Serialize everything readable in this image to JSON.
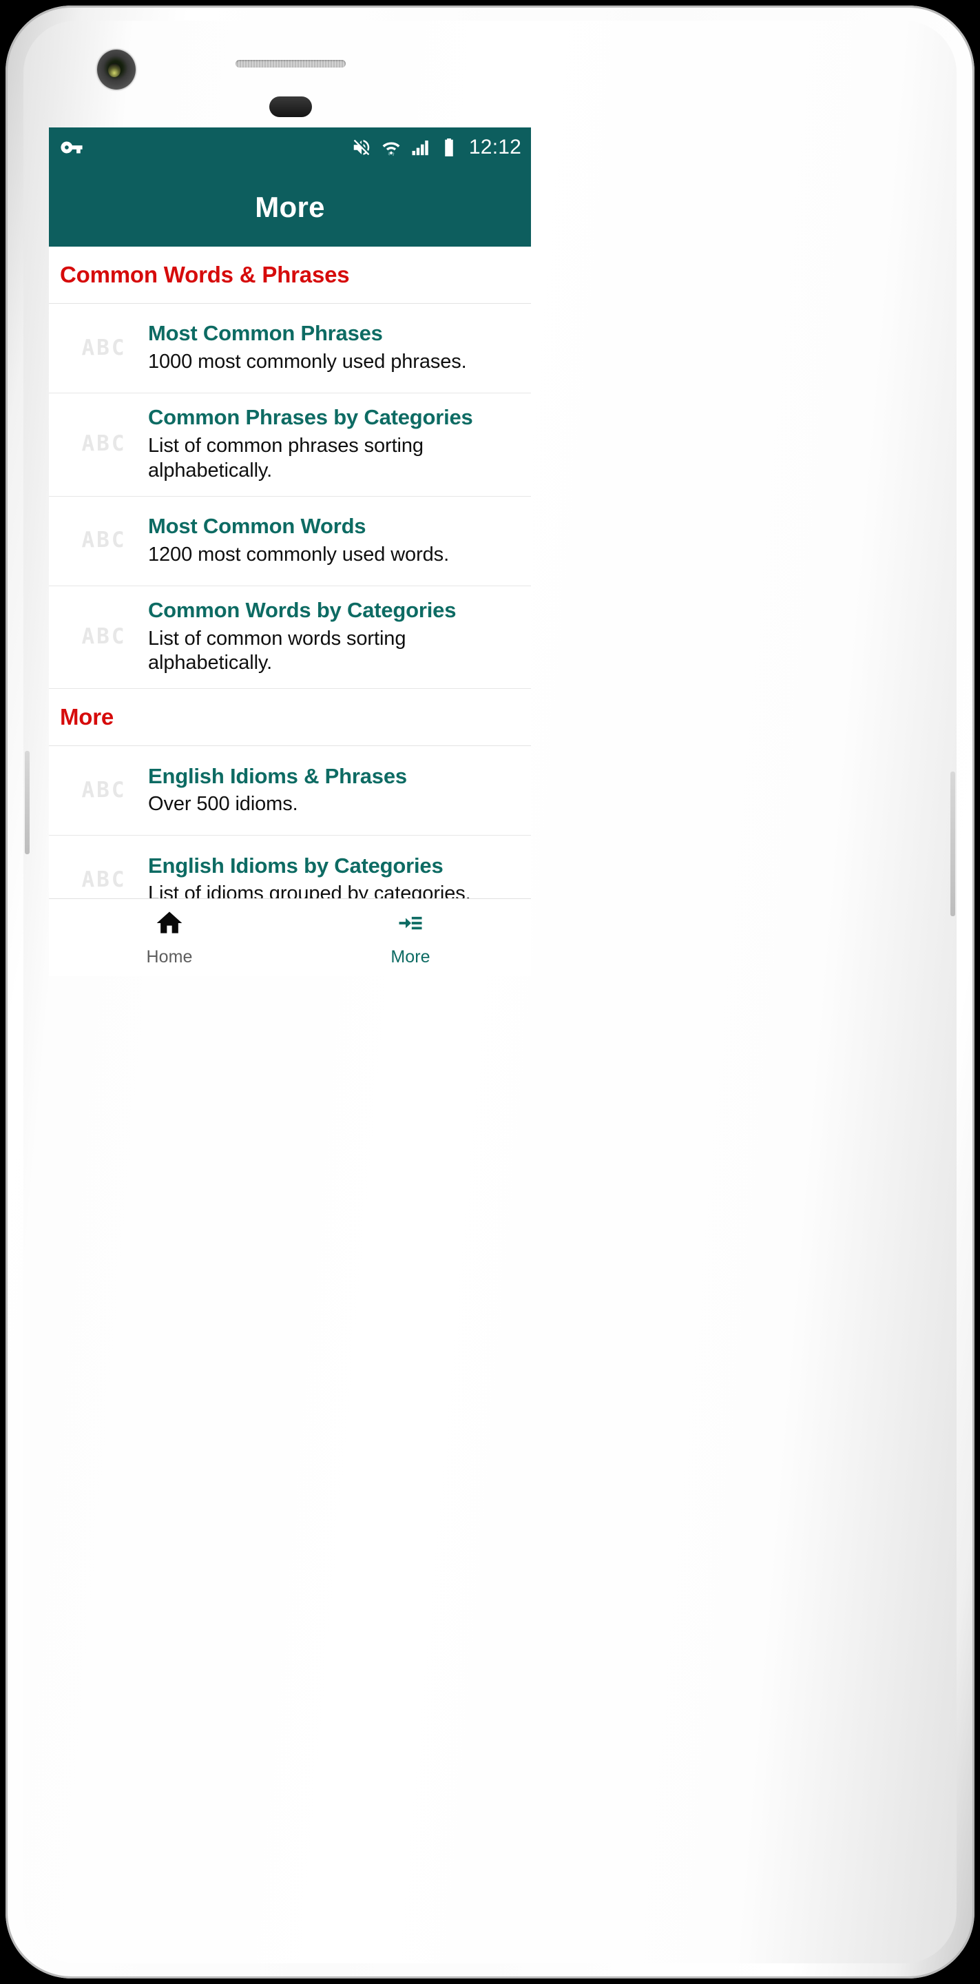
{
  "device": {
    "camera": "front-camera",
    "speaker": "earpiece-speaker"
  },
  "status_bar": {
    "background": "#0d5e5e",
    "left_icons": [
      "vpn-key-icon"
    ],
    "right_icons": [
      "volume-off-icon",
      "wifi-icon",
      "signal-cellular-icon",
      "battery-full-icon"
    ],
    "time": "12:12"
  },
  "app_bar": {
    "title": "More",
    "background": "#0d5e5e",
    "title_color": "#ffffff"
  },
  "colors": {
    "primary_teal": "#0d5e5e",
    "item_title_teal": "#0d6b63",
    "section_red": "#d60b0b",
    "icon_gray": "#e7e7e7"
  },
  "sections": [
    {
      "header": "Common Words & Phrases",
      "items": [
        {
          "icon": "abc-icon",
          "icon_text": "ABC",
          "title": "Most Common Phrases",
          "subtitle": "1000 most commonly used phrases."
        },
        {
          "icon": "abc-icon",
          "icon_text": "ABC",
          "title": "Common Phrases by Categories",
          "subtitle": "List of common phrases sorting alphabetically."
        },
        {
          "icon": "abc-icon",
          "icon_text": "ABC",
          "title": "Most Common Words",
          "subtitle": "1200 most commonly used words."
        },
        {
          "icon": "abc-icon",
          "icon_text": "ABC",
          "title": "Common Words by Categories",
          "subtitle": "List of common words sorting alphabetically."
        }
      ]
    },
    {
      "header": "More",
      "items": [
        {
          "icon": "abc-icon",
          "icon_text": "ABC",
          "title": "English Idioms & Phrases",
          "subtitle": "Over 500 idioms."
        },
        {
          "icon": "abc-icon",
          "icon_text": "ABC",
          "title": "English Idioms by Categories",
          "subtitle": "List of idioms grouped by categories."
        }
      ]
    }
  ],
  "bottom_nav": {
    "tabs": [
      {
        "icon": "home-icon",
        "label": "Home",
        "selected": false,
        "color": "#5d5d5d"
      },
      {
        "icon": "read-more-icon",
        "label": "More",
        "selected": true,
        "color": "#0d6b63"
      }
    ]
  }
}
